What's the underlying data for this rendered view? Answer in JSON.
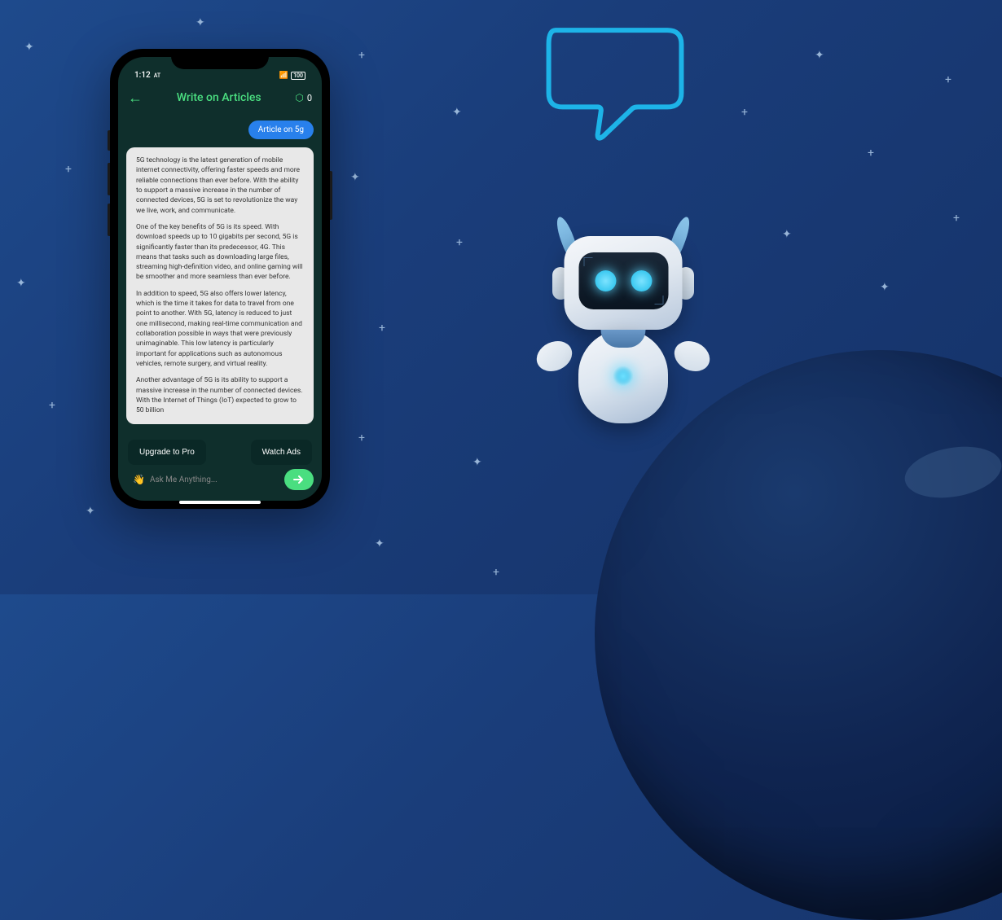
{
  "status": {
    "time": "1:12",
    "network": "AT",
    "signal": "▪▪▪▪",
    "battery": "100"
  },
  "header": {
    "title": "Write on Articles",
    "coins": "0"
  },
  "chat": {
    "user_message": "Article on 5g",
    "bot_p1": "5G technology is the latest generation of mobile internet connectivity, offering faster speeds and more reliable connections than ever before. With the ability to support a massive increase in the number of connected devices, 5G is set to revolutionize the way we live, work, and communicate.",
    "bot_p2": "One of the key benefits of 5G is its speed. With download speeds up to 10 gigabits per second, 5G is significantly faster than its predecessor, 4G. This means that tasks such as downloading large files, streaming high-definition video, and online gaming will be smoother and more seamless than ever before.",
    "bot_p3": "In addition to speed, 5G also offers lower latency, which is the time it takes for data to travel from one point to another. With 5G, latency is reduced to just one millisecond, making real-time communication and collaboration possible in ways that were previously unimaginable. This low latency is particularly important for applications such as autonomous vehicles, remote surgery, and virtual reality.",
    "bot_p4": "Another advantage of 5G is its ability to support a massive increase in the number of connected devices. With the Internet of Things (IoT) expected to grow to 50 billion"
  },
  "actions": {
    "upgrade": "Upgrade to Pro",
    "watch": "Watch Ads"
  },
  "input": {
    "placeholder": "Ask Me Anything..."
  }
}
